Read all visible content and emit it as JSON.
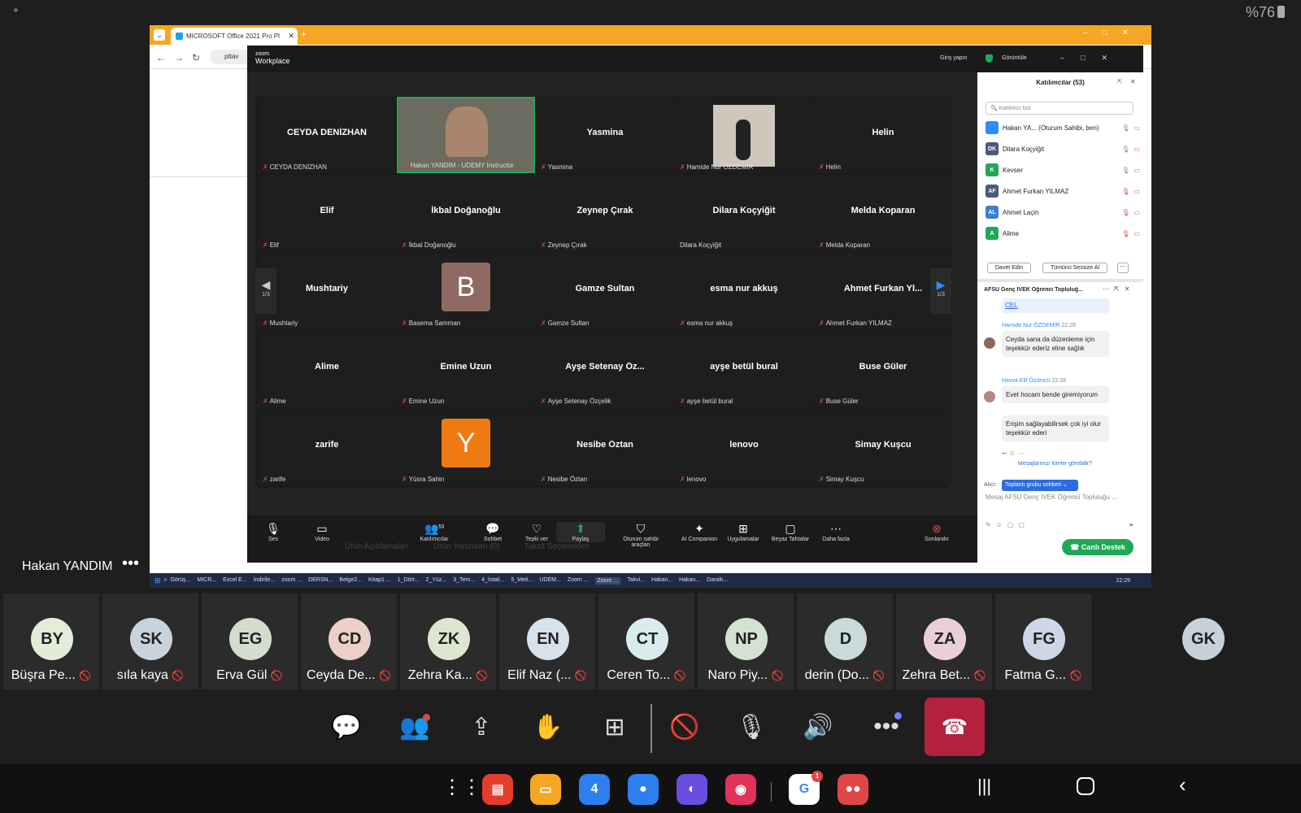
{
  "status": {
    "battery": "%76"
  },
  "browser": {
    "tab_title": "MICROSOFT Office 2021 Pro Pl",
    "url_fragment": "pttav"
  },
  "zoom": {
    "app_name": "zoom",
    "app_sub": "Workplace",
    "signin": "Giriş yapın",
    "view": "Görüntüle",
    "page_indicator": "1/3",
    "tiles": [
      {
        "name": "CEYDA DENİZHAN",
        "label": "CEYDA DENİZHAN"
      },
      {
        "name": "",
        "label": "Hakan YANDIM - UDEMY Instructor"
      },
      {
        "name": "Yasmina",
        "label": "Yasmina"
      },
      {
        "name": "",
        "label": "Hamide Nur ÖZDEMİR"
      },
      {
        "name": "Helin",
        "label": "Helin"
      },
      {
        "name": "Elif",
        "label": "Elif"
      },
      {
        "name": "İkbal Doğanoğlu",
        "label": "İkbal Doğanoğlu"
      },
      {
        "name": "Zeynep Çırak",
        "label": "Zeynep Çırak"
      },
      {
        "name": "Dilara Koçyiğit",
        "label": "Dilara Koçyiğit"
      },
      {
        "name": "Melda Koparan",
        "label": "Melda Koparan"
      },
      {
        "name": "Mushtariy",
        "label": "Mushtariy"
      },
      {
        "name": "B",
        "label": "Basema Samman"
      },
      {
        "name": "Gamze Sultan",
        "label": "Gamze Sultan"
      },
      {
        "name": "esma nur akkuş",
        "label": "esma nur akkuş"
      },
      {
        "name": "Ahmet Furkan Yl...",
        "label": "Ahmet Furkan YILMAZ"
      },
      {
        "name": "Alime",
        "label": "Alime"
      },
      {
        "name": "Emine Uzun",
        "label": "Emine Uzun"
      },
      {
        "name": "Ayşe Setenay Öz...",
        "label": "Ayşe Setenay Özçelik"
      },
      {
        "name": "ayşe betül bural",
        "label": "ayşe betül bural"
      },
      {
        "name": "Buse Güler",
        "label": "Buse Güler"
      },
      {
        "name": "zarife",
        "label": "zarife"
      },
      {
        "name": "Y",
        "label": "Yüsra Sahin"
      },
      {
        "name": "Nesibe Öztan",
        "label": "Nesibe Öztan"
      },
      {
        "name": "lenovo",
        "label": "lenovo"
      },
      {
        "name": "Simay Kuşcu",
        "label": "Simay Kuşcu"
      }
    ],
    "participants_title": "Katılımcılar (53)",
    "search_placeholder": "Katılımcı bul",
    "participants": [
      {
        "initials": "",
        "name": "Hakan YA... (Oturum Sahibi, ben)",
        "color": "#2d8cff"
      },
      {
        "initials": "DK",
        "name": "Dilara Koçyiğit",
        "color": "#4a5a7a"
      },
      {
        "initials": "K",
        "name": "Kevser",
        "color": "#1fa855"
      },
      {
        "initials": "AF",
        "name": "Ahmet Furkan YILMAZ",
        "color": "#4a5a7a"
      },
      {
        "initials": "AL",
        "name": "Ahmet Laçin",
        "color": "#3a7fd0"
      },
      {
        "initials": "A",
        "name": "Alime",
        "color": "#1fa855"
      }
    ],
    "invite": "Davet Edin",
    "mute_all": "Tümünü Sessize Al",
    "chat_title": "AFSÜ Genç İVEK Öğrenci Topluluğ...",
    "chat_link": "CEL",
    "messages": [
      {
        "sender": "Hamide Nur ÖZDEMİR",
        "time": "22:28",
        "text": "Ceyda sana da düzenleme için teşekkür ederiz eline sağlık"
      },
      {
        "sender": "Havva Elif Özümcü",
        "time": "22:28",
        "text": "Evet hocam bende giremiyorum"
      },
      {
        "sender": "",
        "time": "",
        "text": "Erişim sağlayabilirsek çok iyi olur teşekkür ederi"
      }
    ],
    "who_sees": "Mesajlarınızı kimler görebilir?",
    "recipient_label": "Alıcı:",
    "recipient": "Toplantı grubu sohbeti",
    "message_placeholder": "Mesaj AFSÜ Genç İVEK Öğrenci Topluluğu ...",
    "toolbar": [
      {
        "icon": "mic-icon",
        "glyph": "🎙",
        "label": "Ses"
      },
      {
        "icon": "video-icon",
        "glyph": "▭",
        "label": "Video"
      },
      {
        "icon": "participants-icon",
        "glyph": "👥",
        "label": "Katılımcılar",
        "count": "53"
      },
      {
        "icon": "chat-icon",
        "glyph": "💬",
        "label": "Sohbet"
      },
      {
        "icon": "reaction-icon",
        "glyph": "♡",
        "label": "Tepki ver"
      },
      {
        "icon": "share-icon",
        "glyph": "⬆",
        "label": "Paylaş"
      },
      {
        "icon": "host-tools-icon",
        "glyph": "⛉",
        "label": "Oturum sahibi araçları"
      },
      {
        "icon": "ai-companion-icon",
        "glyph": "✦",
        "label": "AI Companion"
      },
      {
        "icon": "apps-icon",
        "glyph": "⊞",
        "label": "Uygulamalar"
      },
      {
        "icon": "whiteboard-icon",
        "glyph": "▢",
        "label": "Beyaz Tahtalar"
      },
      {
        "icon": "more-icon",
        "glyph": "⋯",
        "label": "Daha fazla"
      }
    ],
    "end": "Sonlandır"
  },
  "page_under": {
    "tabs": [
      "Ürün Açıklamaları",
      "Ürün Yorumları (0)",
      "Taksit Seçenekleri"
    ],
    "support": "Canlı Destek"
  },
  "taskbar": {
    "items": [
      "Görüş...",
      "MICR...",
      "Excel E...",
      "İndirile...",
      "zoom ...",
      "DERSN...",
      "Belge2...",
      "Kitap1 ...",
      "1_Dört...",
      "2_Yüz...",
      "3_Tem...",
      "4_İstati...",
      "5_Meti...",
      "UDEM...",
      "Zoom ...",
      "Zoom ...",
      "Takvi...",
      "Hakan...",
      "Hakan...",
      "Daraltı..."
    ],
    "time": "22:29"
  },
  "presenter": {
    "name": "Hakan YANDIM"
  },
  "strip": [
    {
      "initials": "BY",
      "name": "Büşra Pe...",
      "color": "#e3ecd8"
    },
    {
      "initials": "SK",
      "name": "sıla kaya",
      "color": "#c9d3dc"
    },
    {
      "initials": "EG",
      "name": "Erva Gül",
      "color": "#d4dccb"
    },
    {
      "initials": "CD",
      "name": "Ceyda De...",
      "color": "#ead0c8"
    },
    {
      "initials": "ZK",
      "name": "Zehra Ka...",
      "color": "#dfe6cf"
    },
    {
      "initials": "EN",
      "name": "Elif Naz (...",
      "color": "#d7e3ea"
    },
    {
      "initials": "CT",
      "name": "Ceren To...",
      "color": "#d8ecee"
    },
    {
      "initials": "NP",
      "name": "Naro Piy...",
      "color": "#d3e2d1"
    },
    {
      "initials": "D",
      "name": "derin (Do...",
      "color": "#c9dad8"
    },
    {
      "initials": "ZA",
      "name": "Zehra Bet...",
      "color": "#ead0d6"
    },
    {
      "initials": "FG",
      "name": "Fatma G...",
      "color": "#cdd7e8"
    },
    {
      "initials": "GK",
      "name": "",
      "color": "#c6d1d8"
    }
  ],
  "app_badge": "1",
  "colors": {
    "end_call": "#b3213f",
    "share_green": "#1fa855",
    "zoom_blue": "#2d8cff"
  }
}
